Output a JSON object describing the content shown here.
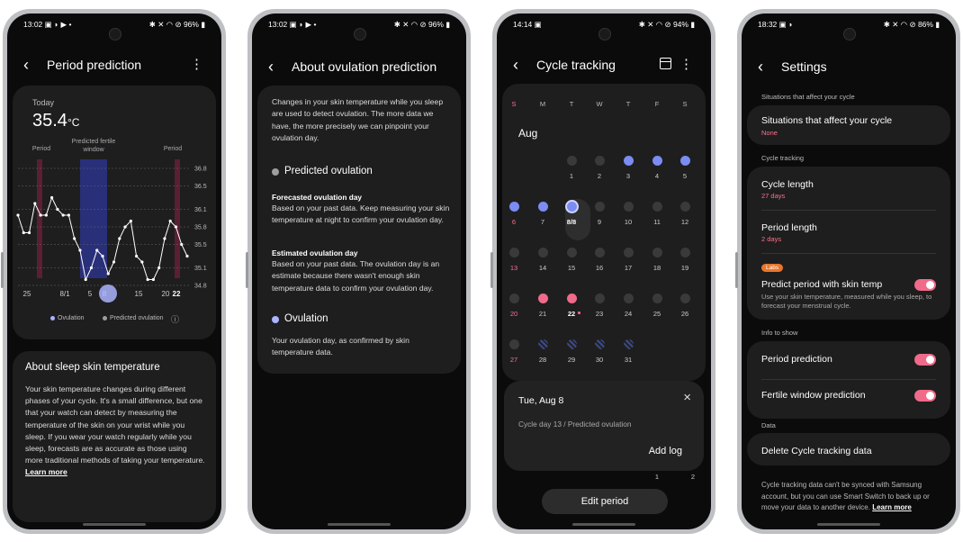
{
  "phone1": {
    "status_time": "13:02",
    "status_left_icons": "▣ ◗ ▶ •",
    "status_right": "✱ ✕ ◠ ⊘ 96% ▮",
    "title": "Period prediction",
    "today_label": "Today",
    "temp_value": "35.4",
    "temp_unit": "°C",
    "chart_labels": {
      "period_left": "Period",
      "fertile": "Predicted fertile window",
      "period_right": "Period"
    },
    "ytick_labels": [
      "36.8",
      "36.5",
      "36.1",
      "35.8",
      "35.5",
      "35.1",
      "34.8"
    ],
    "xtick_labels": [
      "25",
      "8/1",
      "5",
      "8",
      "15",
      "20",
      "22"
    ],
    "legend": {
      "ovulation": "Ovulation",
      "predicted": "Predicted ovulation",
      "info_icon": "ⓘ"
    },
    "about_title": "About sleep skin temperature",
    "about_text": "Your skin temperature changes during different phases of your cycle. It's a small difference, but one that your watch can detect by measuring the temperature of the skin on your wrist while you sleep. If you wear your watch regularly while you sleep, forecasts are as accurate as those using more traditional methods of taking your temperature.",
    "learn_more": "Learn more"
  },
  "chart_data": {
    "type": "line",
    "ylim": [
      34.8,
      36.8
    ],
    "yticks": [
      36.8,
      36.5,
      36.1,
      35.8,
      35.5,
      35.1,
      34.8
    ],
    "x_ticks": [
      "25",
      "8/1",
      "5",
      "8",
      "15",
      "20",
      "22"
    ],
    "series": [
      {
        "values": [
          36.0,
          35.7,
          35.7,
          36.2,
          36.0,
          36.0,
          36.3,
          36.1,
          36.0,
          36.0,
          35.6,
          35.4,
          34.9,
          35.1,
          35.4,
          35.3,
          35.0,
          35.2,
          35.6,
          35.8,
          35.9,
          35.3,
          35.2,
          34.9,
          34.9,
          35.1,
          35.6,
          35.9,
          35.8,
          35.5,
          35.3
        ]
      }
    ]
  },
  "phone2": {
    "status_time": "13:02",
    "status_left_icons": "▣ ◗ ▶ •",
    "status_right": "✱ ✕ ◠ ⊘ 96% ▮",
    "title": "About ovulation prediction",
    "intro": "Changes in your skin temperature while you sleep are used to detect ovulation. The more data we have, the more precisely we can pinpoint your ovulation day.",
    "predicted_heading": "Predicted ovulation",
    "forecasted_title": "Forecasted ovulation day",
    "forecasted_text": "Based on your past data. Keep measuring your skin temperature at night to confirm your ovulation day.",
    "estimated_title": "Estimated ovulation day",
    "estimated_text": "Based on your past data. The ovulation day is an estimate because there wasn't enough skin temperature data to confirm your ovulation day.",
    "ovulation_heading": "Ovulation",
    "ovulation_text": "Your ovulation day, as confirmed by skin temperature data.",
    "colors": {
      "predicted": "#9e9e9e",
      "ovulation": "#aab4ff"
    }
  },
  "phone3": {
    "status_time": "14:14",
    "status_left_icons": "▣",
    "status_right": "✱ ✕ ◠ ⊘ 94% ▮",
    "title": "Cycle tracking",
    "calendar_icon": "calendar-icon",
    "weekdays": [
      "S",
      "M",
      "T",
      "W",
      "T",
      "F",
      "S"
    ],
    "month": "Aug",
    "sheet_date": "Tue, Aug 8",
    "sheet_info": "Cycle day 13 / Predicted ovulation",
    "add_log": "Add log",
    "next_numbers": [
      "1",
      "2"
    ],
    "edit_period": "Edit period",
    "colors": {
      "ovulation": "#7b8cf2",
      "period": "#f06a8a",
      "grey": "#3a3a3a"
    }
  },
  "phone4": {
    "status_time": "18:32",
    "status_left_icons": "▣ ◗",
    "status_right": "✱ ✕ ◠ ⊘ 86% ▮",
    "title": "Settings",
    "sec1": "Situations that affect your cycle",
    "situations_item": "Situations that affect your cycle",
    "situations_value": "None",
    "sec2": "Cycle tracking",
    "cycle_length": "Cycle length",
    "cycle_length_value": "27 days",
    "period_length": "Period length",
    "period_length_value": "2 days",
    "labs": "Labs",
    "predict_skin": "Predict period with skin temp",
    "predict_skin_desc": "Use your skin temperature, measured while you sleep, to forecast your menstrual cycle.",
    "sec3": "Info to show",
    "period_prediction": "Period prediction",
    "fertile_prediction": "Fertile window prediction",
    "sec4": "Data",
    "delete_data": "Delete Cycle tracking data",
    "footer": "Cycle tracking data can't be synced with Samsung account, but you can use Smart Switch to back up or move your data to another device.",
    "footer_link": "Learn more",
    "toggle_color": "#f06a8a"
  }
}
